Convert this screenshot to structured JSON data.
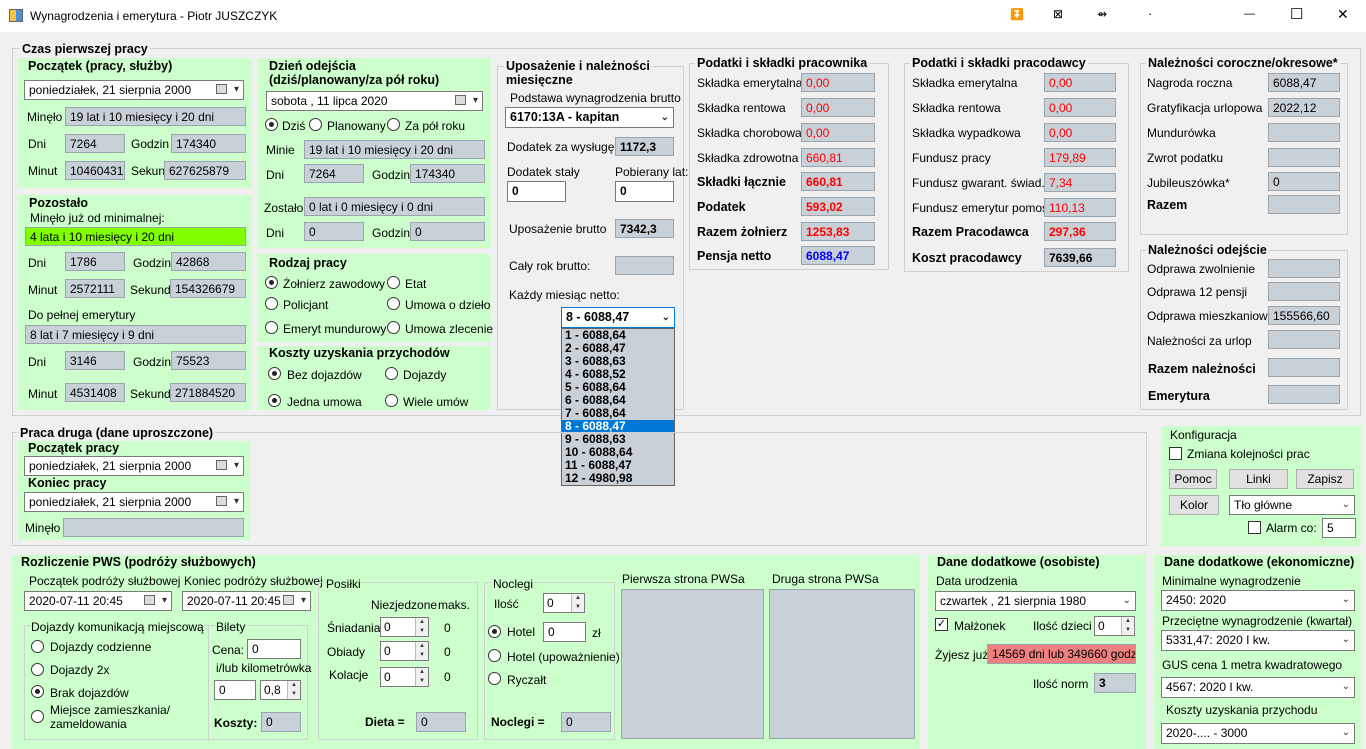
{
  "window": {
    "title": "Wynagrodzenia i emerytura - Piotr JUSZCZYK",
    "btn_a": "⏬",
    "btn_b": "⊠",
    "btn_c": "⇴",
    "btn_d": "·",
    "minimize": "—",
    "maximize": "☐",
    "close": "✕"
  },
  "first_job": {
    "title": "Czas pierwszej pracy",
    "start": {
      "title": "Początek (pracy, służby)",
      "date": "poniedziałek, 21    sierpnia     2000",
      "passed_label": "Minęło",
      "passed": "19 lat i 10 miesięcy i 20 dni",
      "days_label": "Dni",
      "days": "7264",
      "hours_label": "Godzin",
      "hours": "174340",
      "minutes_label": "Minut",
      "minutes": "10460431",
      "seconds_label": "Sekund",
      "seconds": "627625879"
    },
    "left": {
      "title": "Pozostało",
      "since_min_label": "Minęło już od minimalnej:",
      "since_min": "4 lata i 10 miesięcy i 20 dni",
      "days_label": "Dni",
      "days": "1786",
      "hours_label": "Godzin",
      "hours": "42868",
      "minutes_label": "Minut",
      "minutes": "2572111",
      "seconds_label": "Sekund",
      "seconds": "154326679",
      "to_full_label": "Do pełnej emerytury",
      "to_full": "8 lat i 7 miesięcy i 9 dni",
      "days2": "3146",
      "hours2": "75523",
      "minutes2": "4531408",
      "seconds2": "271884520"
    },
    "leave": {
      "title": "Dzień odejścia\n(dziś/planowany/za pół roku)",
      "date": "sobota    , 11       lipca        2020",
      "opt_today": "Dziś",
      "opt_planned": "Planowany",
      "opt_half": "Za pół roku",
      "minie_label": "Minie",
      "minie": "19 lat i 10 miesięcy i 20 dni",
      "days_label": "Dni",
      "days": "7264",
      "hours_label": "Godzin",
      "hours": "174340",
      "zostalo_label": "Zostało",
      "zostalo": "0 lat i 0 miesięcy i 0 dni",
      "days2_label": "Dni",
      "days2": "0",
      "hours2_label": "Godzin",
      "hours2": "0"
    },
    "work_type": {
      "title": "Rodzaj pracy",
      "o1": "Żołnierz zawodowy",
      "o2": "Etat",
      "o3": "Policjant",
      "o4": "Umowa o dzieło",
      "o5": "Emeryt mundurowy",
      "o6": "Umowa zlecenie"
    },
    "costs": {
      "title": "Koszty uzyskania przychodów",
      "o1": "Bez dojazdów",
      "o2": "Dojazdy",
      "o3": "Jedna umowa",
      "o4": "Wiele umów"
    }
  },
  "salary": {
    "title": "Uposażenie i należności\nmiesięczne",
    "base_label": "Podstawa wynagrodzenia brutto",
    "base": "6170:13A - kapitan",
    "seniority_label": "Dodatek za wysługę",
    "seniority": "1172,3",
    "fixed_label": "Dodatek stały",
    "fixed": "0",
    "years_label": "Pobierany lat:",
    "years": "0",
    "gross_label": "Uposażenie brutto",
    "gross": "7342,3",
    "year_gross_label": "Cały rok brutto:",
    "year_gross": "",
    "monthly_label": "Każdy miesiąc netto:",
    "monthly_selected": "8 - 6088,47",
    "months": [
      "1 - 6088,64",
      "2 - 6088,47",
      "3 - 6088,63",
      "4 - 6088,52",
      "5 - 6088,64",
      "6 - 6088,64",
      "7 - 6088,64",
      "8 - 6088,47",
      "9 - 6088,63",
      "10 - 6088,64",
      "11 - 6088,47",
      "12 - 4980,98"
    ]
  },
  "employee_tax": {
    "title": "Podatki i składki pracownika",
    "r1": "Składka emerytalna",
    "v1": "0,00",
    "r2": "Składka rentowa",
    "v2": "0,00",
    "r3": "Składka chorobowa",
    "v3": "0,00",
    "r4": "Składka zdrowotna",
    "v4": "660,81",
    "r5": "Składki łącznie",
    "v5": "660,81",
    "r6": "Podatek",
    "v6": "593,02",
    "r7": "Razem żołnierz",
    "v7": "1253,83",
    "r8": "Pensja netto",
    "v8": "6088,47"
  },
  "employer_tax": {
    "title": "Podatki i składki pracodawcy",
    "r1": "Składka emerytalna",
    "v1": "0,00",
    "r2": "Składka rentowa",
    "v2": "0,00",
    "r3": "Składka wypadkowa",
    "v3": "0,00",
    "r4": "Fundusz pracy",
    "v4": "179,89",
    "r5": "Fundusz gwarant. świad.",
    "v5": "7,34",
    "r6": "Fundusz emerytur pomost.",
    "v6": "110,13",
    "r7": "Razem Pracodawca",
    "v7": "297,36",
    "r8": "Koszt pracodawcy",
    "v8": "7639,66"
  },
  "annual": {
    "title": "Należności coroczne/okresowe*",
    "r1": "Nagroda roczna",
    "v1": "6088,47",
    "r2": "Gratyfikacja urlopowa",
    "v2": "2022,12",
    "r3": "Mundurówka",
    "v3": "",
    "r4": "Zwrot podatku",
    "v4": "",
    "r5": "Jubileuszówka*",
    "v5": "0",
    "r6": "Razem",
    "v6": ""
  },
  "leaving": {
    "title": "Należności odejście",
    "r1": "Odprawa zwolnienie",
    "v1": "",
    "r2": "Odprawa 12 pensji",
    "v2": "",
    "r3": "Odprawa mieszkaniowa",
    "v3": "155566,60",
    "r4": "Należności za urlop",
    "v4": "",
    "r5": "Razem należności",
    "v5": "",
    "r6": "Emerytura",
    "v6": ""
  },
  "second_job": {
    "title": "Praca druga (dane uproszczone)",
    "start_label": "Początek pracy",
    "start": "poniedziałek, 21    sierpnia     2000",
    "end_label": "Koniec pracy",
    "end": "poniedziałek, 21    sierpnia     2000",
    "passed_label": "Minęło",
    "passed": ""
  },
  "config": {
    "title": "Konfiguracja",
    "order": "Zmiana kolejności prac",
    "help": "Pomoc",
    "links": "Linki",
    "save": "Zapisz",
    "color": "Kolor",
    "bg": "Tło główne",
    "alarm": "Alarm co:",
    "alarm_val": "5"
  },
  "trips": {
    "title": "Rozliczenie PWS (podróży służbowych)",
    "start_label": "Początek podróży służbowej",
    "start": "2020-07-11   20:45",
    "end_label": "Koniec podróży służbowej",
    "end": "2020-07-11   20:45",
    "commute": {
      "title": "Dojazdy komunikacją miejscową",
      "o1": "Dojazdy codzienne",
      "o2": "Dojazdy 2x",
      "o3": "Brak dojazdów",
      "o4": "Miejsce zamieszkania/\nzameldowania"
    },
    "tickets": {
      "title": "Bilety",
      "price_label": "Cena:",
      "price": "0",
      "km_label": "i/lub kilometrówka",
      "km": "0",
      "rate": "0,8",
      "costs_label": "Koszty:",
      "costs": "0"
    },
    "meals": {
      "title": "Posiłki",
      "col1": "Niezjedzone",
      "col2": "maks.",
      "r1": "Śniadania",
      "v1": "0",
      "m1": "0",
      "r2": "Obiady",
      "v2": "0",
      "m2": "0",
      "r3": "Kolacje",
      "v3": "0",
      "m3": "0",
      "diet_label": "Dieta =",
      "diet": "0"
    },
    "nights": {
      "title": "Noclegi",
      "count_label": "Ilość",
      "count": "0",
      "o1": "Hotel",
      "hotel_val": "0",
      "currency": "zł",
      "o2": "Hotel (upoważnienie)",
      "o3": "Ryczałt",
      "sum_label": "Noclegi =",
      "sum": "0"
    },
    "page1": "Pierwsza  strona PWSa",
    "page2": "Druga  strona PWSa"
  },
  "personal": {
    "title": "Dane dodatkowe (osobiste)",
    "birth_label": "Data urodzenia",
    "birth": "czwartek  , 21     sierpnia      1980",
    "spouse": "Małżonek",
    "kids_label": "Ilość dzieci",
    "kids": "0",
    "alive_label": "Żyjesz już:",
    "alive": "14569 dni lub 349660 godzin",
    "norm_label": "Ilość norm",
    "norm": "3"
  },
  "economic": {
    "title": "Dane dodatkowe (ekonomiczne)",
    "min_label": "Minimalne wynagrodzenie",
    "min": "2450: 2020",
    "avg_label": "Przeciętne wynagrodzenie (kwartał)",
    "avg": "5331,47: 2020 I kw.",
    "gus_label": "GUS cena 1 metra kwadratowego",
    "gus": "4567: 2020 I kw.",
    "costs_label": "Koszty uzyskania przychodu",
    "costs": "2020-.... - 3000"
  }
}
